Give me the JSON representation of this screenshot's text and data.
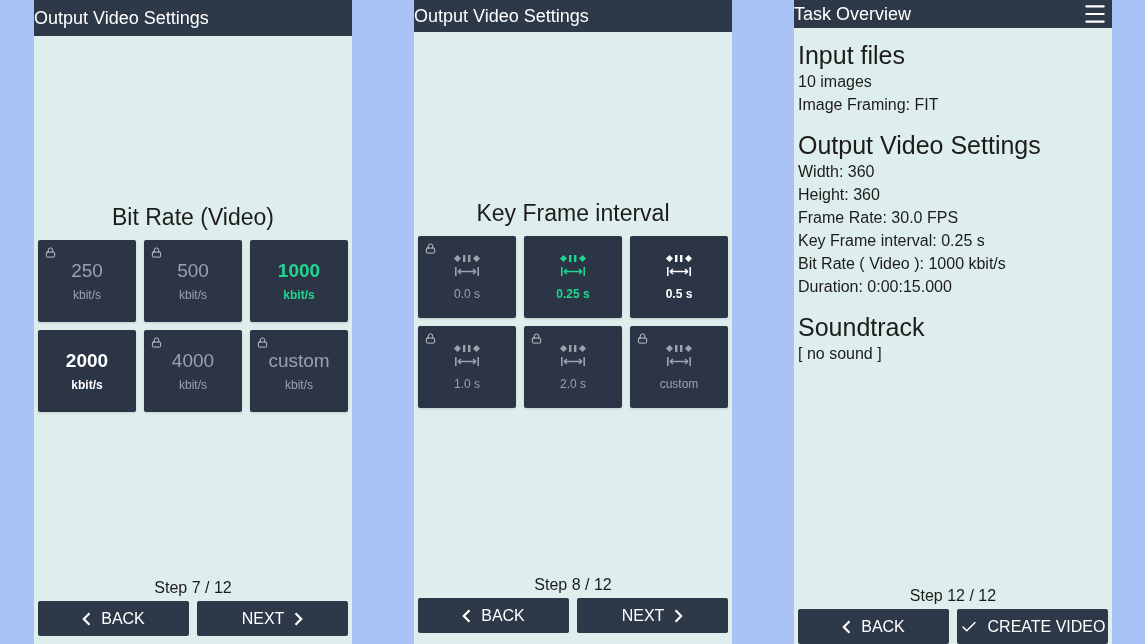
{
  "screens": [
    {
      "kind": "value-grid",
      "title": "Output Video Settings",
      "heading": "Bit Rate (Video)",
      "tiles": [
        {
          "value": "250",
          "unit": "kbit/s",
          "locked": true,
          "selected": false
        },
        {
          "value": "500",
          "unit": "kbit/s",
          "locked": true,
          "selected": false
        },
        {
          "value": "1000",
          "unit": "kbit/s",
          "locked": false,
          "selected": true
        },
        {
          "value": "2000",
          "unit": "kbit/s",
          "locked": false,
          "selected": false
        },
        {
          "value": "4000",
          "unit": "kbit/s",
          "locked": true,
          "selected": false
        },
        {
          "value": "custom",
          "unit": "kbit/s",
          "locked": true,
          "selected": false
        }
      ],
      "step": "Step 7 / 12",
      "buttons": [
        {
          "kind": "back",
          "label": "BACK"
        },
        {
          "kind": "next",
          "label": "NEXT"
        }
      ]
    },
    {
      "kind": "icon-grid",
      "title": "Output Video Settings",
      "heading": "Key Frame interval",
      "tiles": [
        {
          "value": "0.0 s",
          "locked": true,
          "selected": false
        },
        {
          "value": "0.25 s",
          "locked": false,
          "selected": true
        },
        {
          "value": "0.5 s",
          "locked": false,
          "selected": false
        },
        {
          "value": "1.0 s",
          "locked": true,
          "selected": false
        },
        {
          "value": "2.0 s",
          "locked": true,
          "selected": false
        },
        {
          "value": "custom",
          "locked": true,
          "selected": false
        }
      ],
      "step": "Step 8 / 12",
      "buttons": [
        {
          "kind": "back",
          "label": "BACK"
        },
        {
          "kind": "next",
          "label": "NEXT"
        }
      ]
    },
    {
      "kind": "overview",
      "title": "Task Overview",
      "sections": [
        {
          "heading": "Input files",
          "lines": [
            "10 images",
            "Image Framing: FIT"
          ]
        },
        {
          "heading": "Output Video Settings",
          "lines": [
            "Width: 360",
            "Height: 360",
            "Frame Rate: 30.0 FPS",
            "Key Frame interval: 0.25 s",
            "Bit Rate ( Video ): 1000 kbit/s",
            "Duration: 0:00:15.000"
          ]
        },
        {
          "heading": "Soundtrack",
          "lines": [
            "[ no sound ]"
          ]
        }
      ],
      "step": "Step 12 / 12",
      "buttons": [
        {
          "kind": "back",
          "label": "BACK"
        },
        {
          "kind": "create",
          "label": "CREATE VIDEO"
        }
      ]
    }
  ]
}
